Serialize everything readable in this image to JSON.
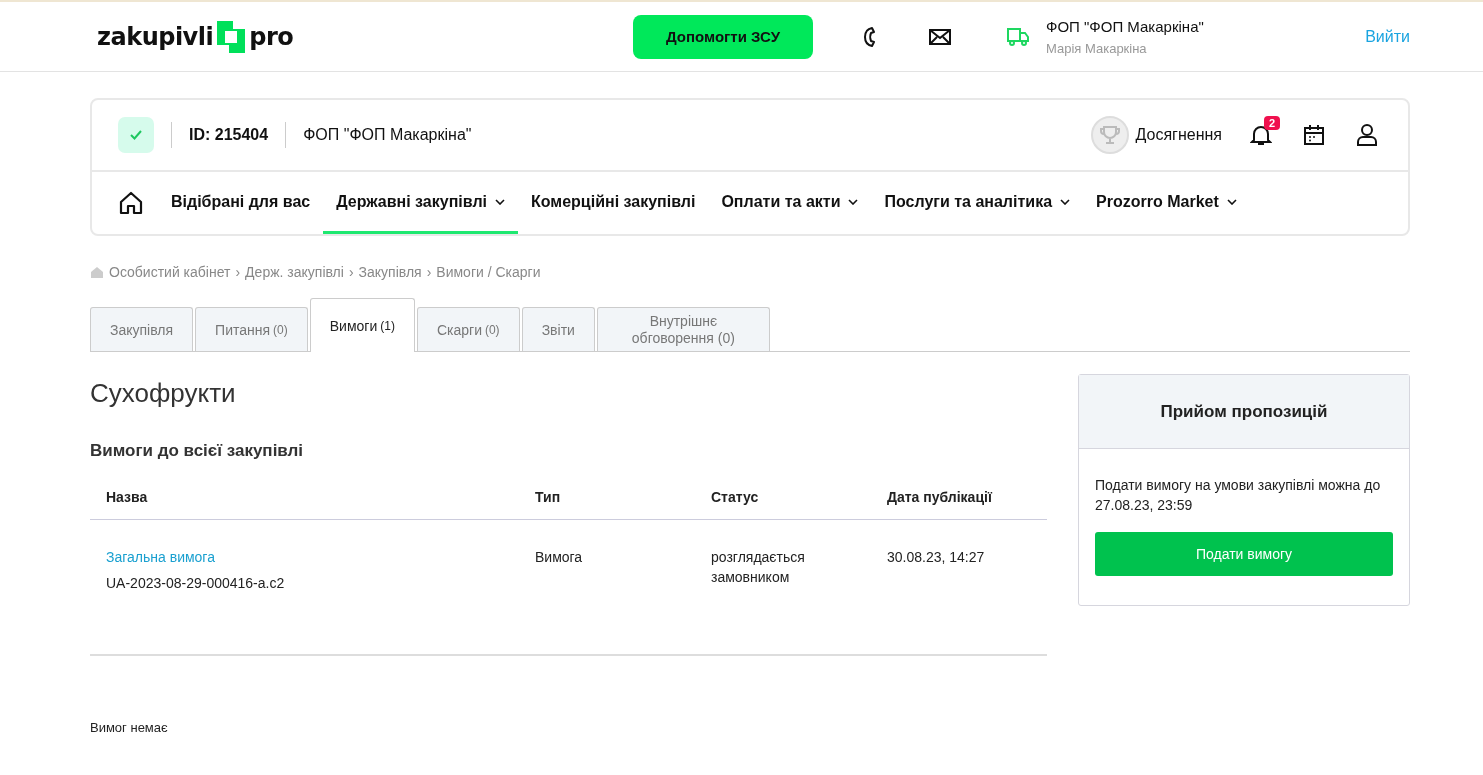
{
  "header": {
    "logo": {
      "left": "zakupivli",
      "right": "pro"
    },
    "help_button": "Допомогти ЗСУ",
    "account": {
      "org": "ФОП \"ФОП Макаркіна\"",
      "user": "Марія Макаркіна"
    },
    "logout": "Вийти"
  },
  "profile_bar": {
    "verified": true,
    "id": "ID: 215404",
    "org": "ФОП \"ФОП Макаркіна\"",
    "achievements": "Досягнення",
    "notifications_count": "2"
  },
  "nav": [
    {
      "label": "Відібрані для вас",
      "dropdown": false,
      "selected": false
    },
    {
      "label": "Державні закупівлі",
      "dropdown": true,
      "selected": true
    },
    {
      "label": "Комерційні закупівлі",
      "dropdown": false,
      "selected": false
    },
    {
      "label": "Оплати та акти",
      "dropdown": true,
      "selected": false
    },
    {
      "label": "Послуги та аналітика",
      "dropdown": true,
      "selected": false
    },
    {
      "label": "Prozorro Market",
      "dropdown": true,
      "selected": false
    }
  ],
  "breadcrumbs": {
    "separator": "›",
    "items": [
      "Особистий кабінет",
      "Держ. закупівлі",
      "Закупівля",
      "Вимоги / Скарги"
    ]
  },
  "tabs": [
    {
      "label": "Закупівля",
      "selected": false
    },
    {
      "label": "Питання",
      "count": "(0)",
      "selected": false
    },
    {
      "label": "Вимоги",
      "count": "(1)",
      "selected": true
    },
    {
      "label": "Скарги",
      "count": "(0)",
      "selected": false
    },
    {
      "label": "Звіти",
      "selected": false
    },
    {
      "label": "Внутрішнє обговорення (0)",
      "selected": false
    }
  ],
  "title": "Сухофрукти",
  "section_title": "Вимоги до всієї закупівлі",
  "table": {
    "columns": [
      "Назва",
      "Тип",
      "Статус",
      "Дата публікації"
    ],
    "rows": [
      {
        "name": "Загальна вимога",
        "number": "UA-2023-08-29-000416-a.c2",
        "type": "Вимога",
        "status": "розглядається замовником",
        "date": "30.08.23, 14:27"
      }
    ]
  },
  "empty_note": "Вимог немає",
  "side_card": {
    "title": "Прийом пропозицій",
    "text": "Подати вимогу на умови закупівлі можна до 27.08.23, 23:59",
    "button": "Подати вимогу"
  }
}
